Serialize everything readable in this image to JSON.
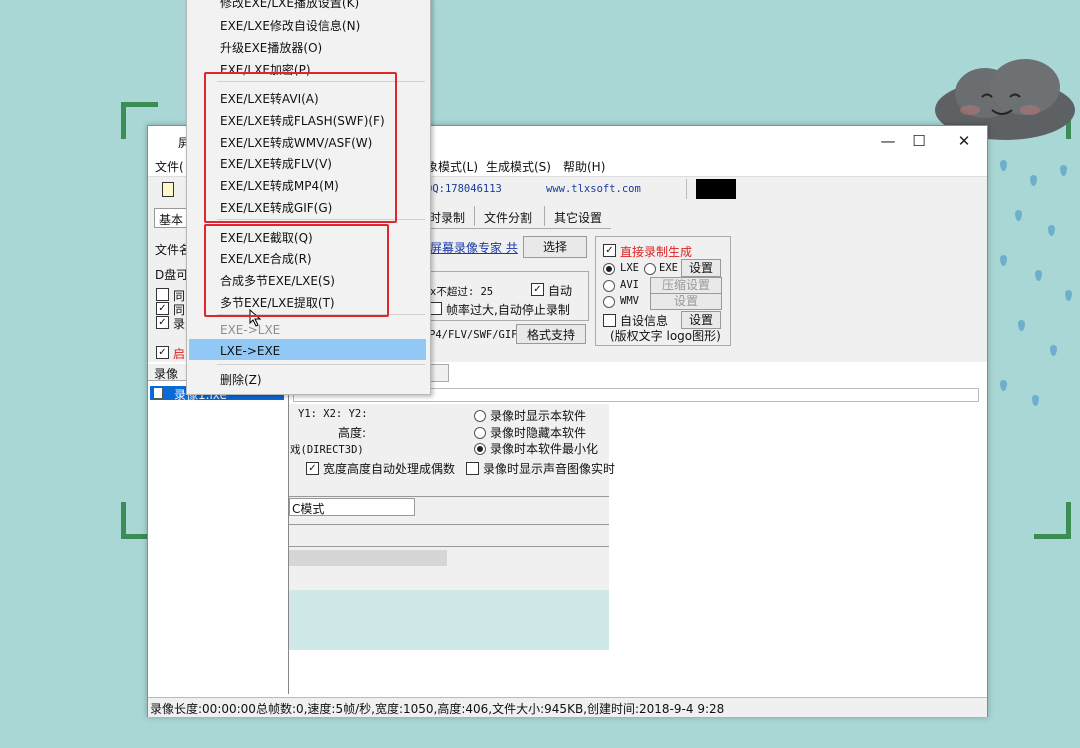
{
  "window": {
    "title_fragment": "屏",
    "controls": {
      "minimize": "—",
      "maximize": "☐",
      "close": "✕"
    }
  },
  "menubar": {
    "file": "文件(",
    "record_mode": "象模式(L)",
    "generate_mode": "生成模式(S)",
    "help": "帮助(H)"
  },
  "toolbar": {
    "qq": "QQ:178046113",
    "site": "www.tlxsoft.com"
  },
  "tabs": {
    "basic": "基本",
    "timed": "时录制",
    "split": "文件分割",
    "other": "其它设置"
  },
  "left_panel": {
    "filename_label": "文件名",
    "drive": "D盘可",
    "cb1": "同",
    "cb2": "同",
    "cb3": "录",
    "start_label": "启",
    "list_header": "录像",
    "file_item": "录像1.lxe"
  },
  "center": {
    "link": "屏幕录像专家 共",
    "select_button": "选择",
    "max_label": "x不超过: 25",
    "auto_label": "自动",
    "frame_label": "帧率过大,自动停止录制",
    "format_prefix": "P4/FLV/SWF/GIF",
    "format_button": "格式支持"
  },
  "right_group": {
    "direct_gen": "直接录制生成",
    "lxe": "LXE",
    "exe": "EXE",
    "avi": "AVI",
    "wmv": "WMV",
    "set1": "设置",
    "compress_set": "压缩设置",
    "set2": "设置",
    "custom_info": "自设信息",
    "set3": "设置",
    "copyright": "(版权文字 logo图形)"
  },
  "lower": {
    "coords": "Y1:      X2:      Y2:",
    "height": "高度:",
    "direct3d": "戏(DIRECT3D)",
    "even": "宽度高度自动处理成偶数",
    "show_soft": "录像时显示本软件",
    "hide_soft": "录像时隐藏本软件",
    "minimize_soft": "录像时本软件最小化",
    "sound_realtime": "录像时显示声音图像实时",
    "mode": "C模式"
  },
  "dropdown": {
    "items_top": [
      "修改EXE/LXE播放设置(K)",
      "EXE/LXE修改自设信息(N)",
      "升级EXE播放器(O)",
      "EXE/LXE加密(P)"
    ],
    "items_convert": [
      "EXE/LXE转AVI(A)",
      "EXE/LXE转成FLASH(SWF)(F)",
      "EXE/LXE转成WMV/ASF(W)",
      "EXE/LXE转成FLV(V)",
      "EXE/LXE转成MP4(M)",
      "EXE/LXE转成GIF(G)"
    ],
    "items_edit": [
      "EXE/LXE截取(Q)",
      "EXE/LXE合成(R)",
      "合成多节EXE/LXE(S)",
      "多节EXE/LXE提取(T)"
    ],
    "disabled": "EXE->LXE",
    "highlighted": "LXE->EXE",
    "delete": "删除(Z)"
  },
  "statusbar": {
    "text": "录像长度:00:00:00总帧数:0,速度:5帧/秒,宽度:1050,高度:406,文件大小:945KB,创建时间:2018-9-4 9:28"
  },
  "colors": {
    "highlight": "#92c8f5",
    "annotation_box": "#e0262b",
    "bracket": "#3c8c55",
    "background": "#a9d7d6"
  }
}
